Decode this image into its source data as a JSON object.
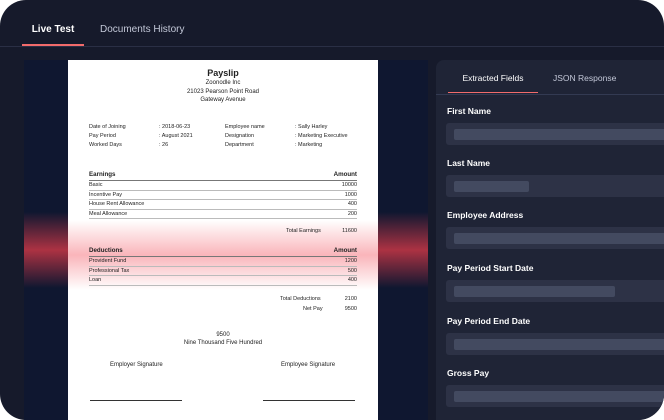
{
  "tabs": {
    "live": "Live Test",
    "history": "Documents History"
  },
  "payslip": {
    "title": "Payslip",
    "company": "Zoonodle Inc",
    "address_line1": "21023 Pearson Point Road",
    "address_line2": "Gateway Avenue",
    "left_info": [
      {
        "key": "Date of Joining",
        "value": ": 2018-06-23"
      },
      {
        "key": "Pay Period",
        "value": ": August 2021"
      },
      {
        "key": "Worked Days",
        "value": ": 26"
      }
    ],
    "right_info": [
      {
        "key": "Employee name",
        "value": ": Sally Harley"
      },
      {
        "key": "Designation",
        "value": ": Marketing Executive"
      },
      {
        "key": "Department",
        "value": ": Marketing"
      }
    ],
    "earnings": {
      "header": "Earnings",
      "amount_header": "Amount",
      "rows": [
        {
          "label": "Basic",
          "amount": "10000"
        },
        {
          "label": "Incentive Pay",
          "amount": "1000"
        },
        {
          "label": "House Rent Allowance",
          "amount": "400"
        },
        {
          "label": "Meal Allowance",
          "amount": "200"
        }
      ],
      "total_label": "Total Earnings",
      "total_value": "11600"
    },
    "deductions": {
      "header": "Deductions",
      "amount_header": "Amount",
      "rows": [
        {
          "label": "Provident Fund",
          "amount": "1200"
        },
        {
          "label": "Professional Tax",
          "amount": "500"
        },
        {
          "label": "Loan",
          "amount": "400"
        }
      ],
      "total_label": "Total Deductions",
      "total_value": "2100"
    },
    "net_pay_label": "Net Pay",
    "net_pay_value": "9500",
    "amount_number": "9500",
    "amount_words": "Nine Thousand Five Hundred",
    "employer_signature": "Employer Signature",
    "employee_signature": "Employee Signature"
  },
  "right_panel": {
    "tabs": {
      "extracted": "Extracted Fields",
      "json": "JSON Response"
    },
    "fields": [
      {
        "label": "First Name",
        "fill": 1.0
      },
      {
        "label": "Last Name",
        "fill": 0.35
      },
      {
        "label": "Employee Address",
        "fill": 1.0
      },
      {
        "label": "Pay Period Start Date",
        "fill": 0.75
      },
      {
        "label": "Pay Period End Date",
        "fill": 1.0
      },
      {
        "label": "Gross Pay",
        "fill": 1.0
      }
    ]
  },
  "colors": {
    "accent": "#f26b6b",
    "background": "#161a2b",
    "panel": "#1f2436"
  }
}
